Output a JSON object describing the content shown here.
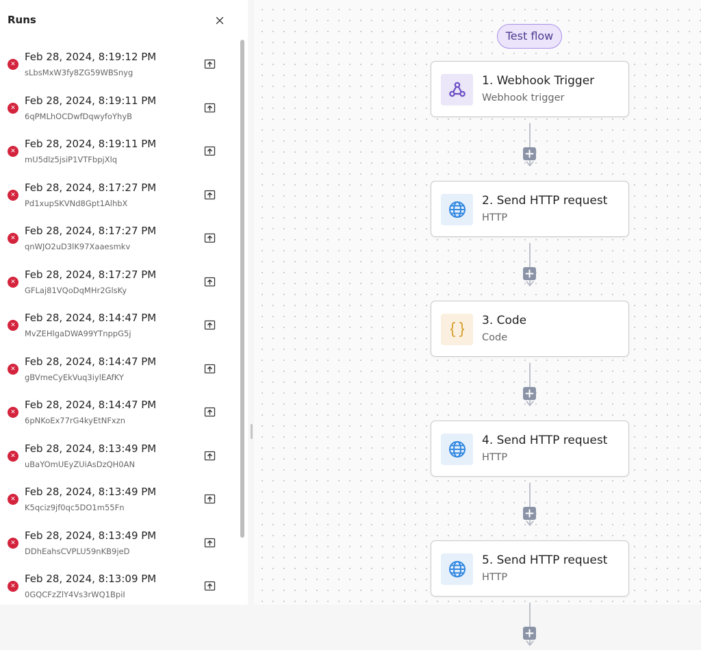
{
  "runs_panel": {
    "title": "Runs",
    "close_icon": "close-icon",
    "runs": [
      {
        "date": "Feb 28, 2024, 8:19:12 PM",
        "id": "sLbsMxW3fy8ZG59WBSnyg",
        "status": "failed"
      },
      {
        "date": "Feb 28, 2024, 8:19:11 PM",
        "id": "6qPMLhOCDwfDqwyfoYhyB",
        "status": "failed"
      },
      {
        "date": "Feb 28, 2024, 8:19:11 PM",
        "id": "mU5dlz5jsiP1VTFbpjXlq",
        "status": "failed"
      },
      {
        "date": "Feb 28, 2024, 8:17:27 PM",
        "id": "Pd1xupSKVNd8Gpt1AlhbX",
        "status": "failed"
      },
      {
        "date": "Feb 28, 2024, 8:17:27 PM",
        "id": "qnWJO2uD3lK97Xaaesmkv",
        "status": "failed"
      },
      {
        "date": "Feb 28, 2024, 8:17:27 PM",
        "id": "GFLaj81VQoDqMHr2GlsKy",
        "status": "failed"
      },
      {
        "date": "Feb 28, 2024, 8:14:47 PM",
        "id": "MvZEHlgaDWA99YTnppG5j",
        "status": "failed"
      },
      {
        "date": "Feb 28, 2024, 8:14:47 PM",
        "id": "gBVmeCyEkVuq3iylEAfKY",
        "status": "failed"
      },
      {
        "date": "Feb 28, 2024, 8:14:47 PM",
        "id": "6pNKoEx77rG4kyEtNFxzn",
        "status": "failed"
      },
      {
        "date": "Feb 28, 2024, 8:13:49 PM",
        "id": "uBaYOmUEyZUiAsDzQH0AN",
        "status": "failed"
      },
      {
        "date": "Feb 28, 2024, 8:13:49 PM",
        "id": "K5qciz9jf0qc5DO1m55Fn",
        "status": "failed"
      },
      {
        "date": "Feb 28, 2024, 8:13:49 PM",
        "id": "DDhEahsCVPLU59nKB9jeD",
        "status": "failed"
      },
      {
        "date": "Feb 28, 2024, 8:13:09 PM",
        "id": "0GQCFzZlY4Vs3rWQ1BpiI",
        "status": "failed"
      }
    ]
  },
  "canvas": {
    "test_flow_label": "Test flow",
    "steps": [
      {
        "title": "1. Webhook Trigger",
        "subtitle": "Webhook trigger",
        "icon": "webhook-icon",
        "accent": "#6a4cc4"
      },
      {
        "title": "2. Send HTTP request",
        "subtitle": "HTTP",
        "icon": "globe-icon",
        "accent": "#2f86e0"
      },
      {
        "title": "3. Code",
        "subtitle": "Code",
        "icon": "code-braces-icon",
        "accent": "#d9a53c"
      },
      {
        "title": "4. Send HTTP request",
        "subtitle": "HTTP",
        "icon": "globe-icon",
        "accent": "#2f86e0"
      },
      {
        "title": "5. Send HTTP request",
        "subtitle": "HTTP",
        "icon": "globe-icon",
        "accent": "#2f86e0"
      }
    ]
  },
  "colors": {
    "error": "#d4233c",
    "test_flow_bg": "#ece4fb",
    "test_flow_border": "#a98ee8",
    "add_button": "#8a93a6",
    "connector": "#b4b9c4"
  }
}
